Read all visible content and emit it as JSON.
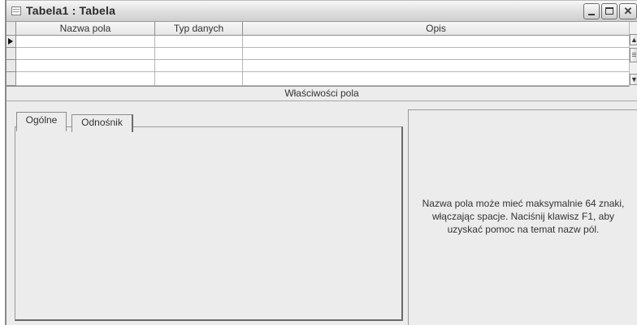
{
  "window": {
    "title": "Tabela1 : Tabela",
    "title_icon": "table-icon",
    "buttons": {
      "minimize": "minimize",
      "maximize": "maximize",
      "close": "✕"
    }
  },
  "grid": {
    "columns": [
      "Nazwa pola",
      "Typ danych",
      "Opis"
    ],
    "rows": [
      [
        "",
        "",
        ""
      ],
      [
        "",
        "",
        ""
      ],
      [
        "",
        "",
        ""
      ],
      [
        "",
        "",
        ""
      ]
    ],
    "current_row_marker": "arrow-right-icon"
  },
  "properties": {
    "header": "Właściwości pola",
    "tabs": [
      {
        "label": "Ogólne",
        "active": true
      },
      {
        "label": "Odnośnik",
        "active": false
      }
    ],
    "help_text": "Nazwa pola może mieć maksymalnie 64 znaki, włączając spacje. Naciśnij klawisz F1, aby uzyskać pomoc na temat nazw pól."
  }
}
